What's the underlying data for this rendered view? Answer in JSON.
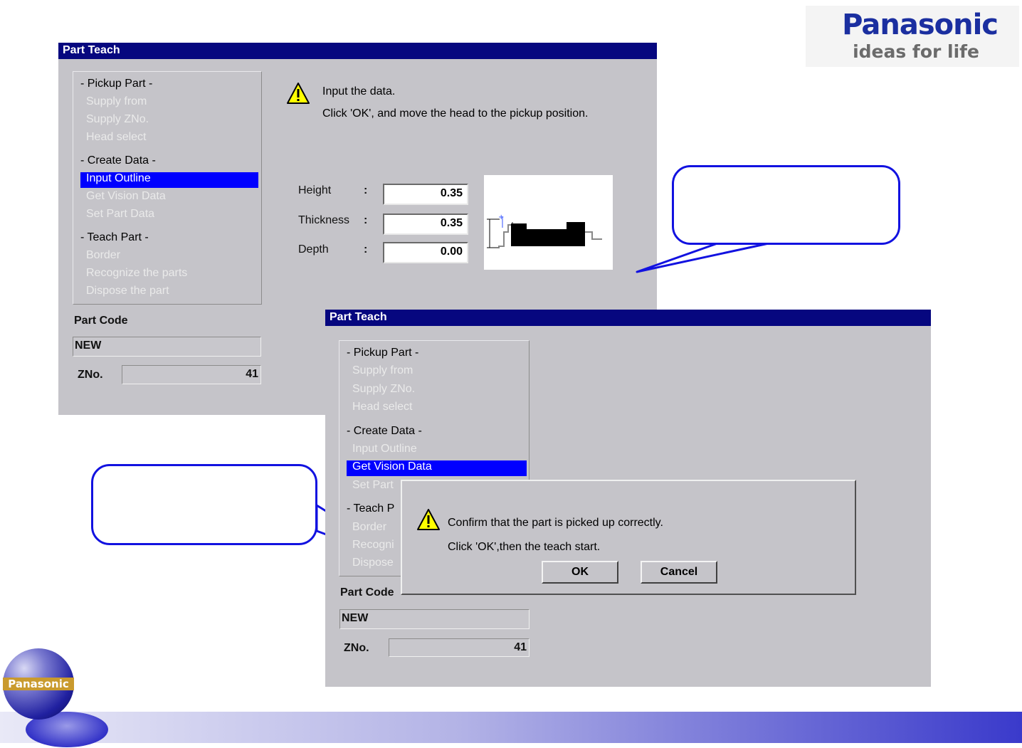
{
  "brand": {
    "name": "Panasonic",
    "tagline": "ideas for life"
  },
  "window_back": {
    "title": "Part Teach",
    "steps": [
      {
        "label": "- Pickup Part -",
        "kind": "hdr"
      },
      {
        "label": "Supply from",
        "kind": "dim"
      },
      {
        "label": "Supply ZNo.",
        "kind": "dim"
      },
      {
        "label": "Head select",
        "kind": "dim"
      },
      {
        "label": "- Create Data -",
        "kind": "hdr"
      },
      {
        "label": "Input Outline",
        "kind": "sel"
      },
      {
        "label": "Get Vision Data",
        "kind": "dim"
      },
      {
        "label": "Set Part Data",
        "kind": "dim"
      },
      {
        "label": "- Teach Part -",
        "kind": "hdr"
      },
      {
        "label": "Border",
        "kind": "dim"
      },
      {
        "label": "Recognize the parts",
        "kind": "dim"
      },
      {
        "label": "Dispose the part",
        "kind": "dim"
      }
    ],
    "message_line1": "Input the data.",
    "message_line2": "Click 'OK', and move the head to the pickup position.",
    "height_label": "Height",
    "height_colon": ":",
    "height_value": "0.35",
    "thickness_label": "Thickness",
    "thickness_colon": ":",
    "thickness_value": "0.35",
    "depth_label": "Depth",
    "depth_colon": ":",
    "depth_value": "0.00",
    "part_code_label": "Part Code",
    "part_code_value": "NEW",
    "zno_label": "ZNo.",
    "zno_value": "41"
  },
  "window_front": {
    "title": "Part Teach",
    "steps": [
      {
        "label": "- Pickup Part -",
        "kind": "hdr"
      },
      {
        "label": "Supply from",
        "kind": "dim"
      },
      {
        "label": "Supply ZNo.",
        "kind": "dim"
      },
      {
        "label": "Head select",
        "kind": "dim"
      },
      {
        "label": "- Create Data -",
        "kind": "hdr"
      },
      {
        "label": "Input Outline",
        "kind": "dim"
      },
      {
        "label": "Get Vision Data",
        "kind": "sel"
      },
      {
        "label": "Set Part",
        "kind": "dim"
      },
      {
        "label": "- Teach P",
        "kind": "hdr"
      },
      {
        "label": "Border",
        "kind": "dim"
      },
      {
        "label": "Recogni",
        "kind": "dim"
      },
      {
        "label": "Dispose",
        "kind": "dim"
      }
    ],
    "part_code_label": "Part Code",
    "part_code_value": "NEW",
    "zno_label": "ZNo.",
    "zno_value": "41"
  },
  "dialog": {
    "message_line1": "Confirm that the part is picked up correctly.",
    "message_line2": "Click 'OK',then the teach start.",
    "ok_label": "OK",
    "cancel_label": "Cancel"
  },
  "logo": {
    "text": "Panasonic"
  },
  "colors": {
    "titlebar": "#06077f",
    "selection": "#0000ff",
    "callout_border": "#1212e0",
    "window_bg": "#c5c4c9"
  },
  "icons": [
    "warning-icon",
    "part-outline-diagram",
    "panasonic-globe-logo"
  ]
}
